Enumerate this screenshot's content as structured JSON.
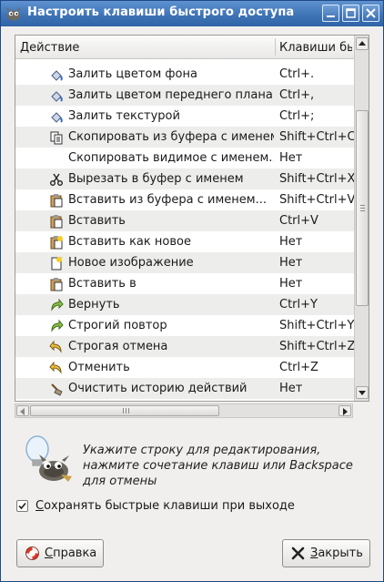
{
  "window": {
    "title": "Настроить клавиши быстрого доступа"
  },
  "list": {
    "columns": {
      "action": "Действие",
      "keys": "Клавиши бы"
    },
    "rows": [
      {
        "icon": "fill-bg-icon",
        "label": "Залить цветом фона",
        "keys": "Ctrl+."
      },
      {
        "icon": "fill-fg-icon",
        "label": "Залить цветом переднего плана",
        "keys": "Ctrl+,"
      },
      {
        "icon": "fill-pattern-icon",
        "label": "Залить текстурой",
        "keys": "Ctrl+;"
      },
      {
        "icon": "copy-named-icon",
        "label": "Скопировать из буфера с именем",
        "keys": "Shift+Ctrl+C"
      },
      {
        "icon": "",
        "label": "Скопировать видимое с именем...",
        "keys": "Нет"
      },
      {
        "icon": "scissors-icon",
        "label": "Вырезать в буфер с именем",
        "keys": "Shift+Ctrl+X"
      },
      {
        "icon": "paste-named-icon",
        "label": "Вставить из буфера с именем...",
        "keys": "Shift+Ctrl+V"
      },
      {
        "icon": "paste-icon",
        "label": "Вставить",
        "keys": "Ctrl+V"
      },
      {
        "icon": "paste-new-icon",
        "label": "Вставить как новое",
        "keys": "Нет"
      },
      {
        "icon": "new-image-icon",
        "label": "Новое изображение",
        "keys": "Нет"
      },
      {
        "icon": "paste-into-icon",
        "label": "Вставить в",
        "keys": "Нет"
      },
      {
        "icon": "redo-icon",
        "label": "Вернуть",
        "keys": "Ctrl+Y"
      },
      {
        "icon": "strong-redo-icon",
        "label": "Строгий повтор",
        "keys": "Shift+Ctrl+Y"
      },
      {
        "icon": "strong-undo-icon",
        "label": "Строгая отмена",
        "keys": "Shift+Ctrl+Z"
      },
      {
        "icon": "undo-icon",
        "label": "Отменить",
        "keys": "Ctrl+Z"
      },
      {
        "icon": "clear-history-icon",
        "label": "Очистить историю действий",
        "keys": "Нет"
      }
    ]
  },
  "hint": {
    "text": "Укажите строку для редактирования, нажмите сочетание клавиш или Backspace для отмены"
  },
  "save_on_exit": {
    "checked": true,
    "label_underlined": "С",
    "label_rest": "охранять быстрые клавиши при выходе"
  },
  "buttons": {
    "help_underlined": "С",
    "help_rest": "правка",
    "close_underlined": "З",
    "close_rest": "акрыть"
  },
  "colors": {
    "titlebar": "#3f74b6",
    "row_alt": "#ededec"
  }
}
